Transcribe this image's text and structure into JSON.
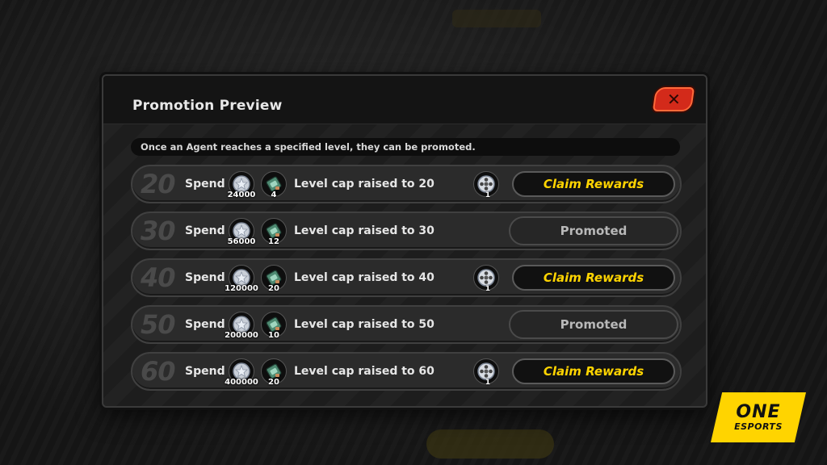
{
  "dialog": {
    "title": "Promotion Preview",
    "close_icon": "close-icon",
    "notice": "Once an Agent reaches a specified level, they can be promoted.",
    "spend_label": "Spend"
  },
  "rows": [
    {
      "level": "20",
      "coin_qty": "24000",
      "mat_qty": "4",
      "cap": "Level cap raised to 20",
      "reward_qty": "1",
      "status": "Claim Rewards"
    },
    {
      "level": "30",
      "coin_qty": "56000",
      "mat_qty": "12",
      "cap": "Level cap raised to 30",
      "reward_qty": "",
      "status": "Promoted"
    },
    {
      "level": "40",
      "coin_qty": "120000",
      "mat_qty": "20",
      "cap": "Level cap raised to 40",
      "reward_qty": "1",
      "status": "Claim Rewards"
    },
    {
      "level": "50",
      "coin_qty": "200000",
      "mat_qty": "10",
      "cap": "Level cap raised to 50",
      "reward_qty": "",
      "status": "Promoted"
    },
    {
      "level": "60",
      "coin_qty": "400000",
      "mat_qty": "20",
      "cap": "Level cap raised to 60",
      "reward_qty": "1",
      "status": "Claim Rewards"
    }
  ],
  "icons": {
    "coin": "dennies-coin-icon",
    "material": "promotion-material-icon",
    "reward": "film-reel-icon"
  },
  "colors": {
    "accent": "#ffd400",
    "close": "#d32a1a"
  },
  "watermark": {
    "line1": "ONE",
    "line2": "ESPORTS"
  }
}
